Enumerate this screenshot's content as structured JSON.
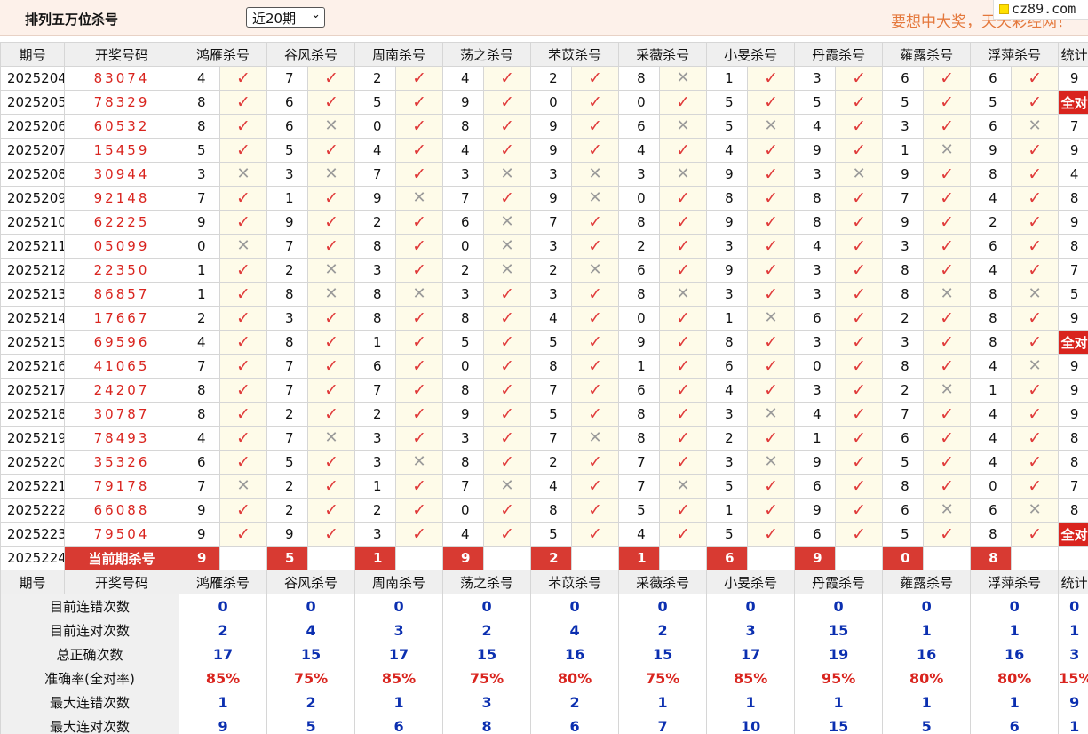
{
  "header": {
    "title": "排列五万位杀号",
    "period_select": "近20期",
    "slogan": "要想中大奖，天天彩经网！",
    "logo": "cz89.com"
  },
  "columns": {
    "period": "期号",
    "draw": "开奖号码",
    "experts": [
      "鸿雁杀号",
      "谷风杀号",
      "周南杀号",
      "荡之杀号",
      "芣苡杀号",
      "采薇杀号",
      "小旻杀号",
      "丹霞杀号",
      "蕹露杀号",
      "浮萍杀号"
    ],
    "stat": "统计"
  },
  "marks": {
    "ok": "✓",
    "ng": "✕",
    "all_ok": "全对"
  },
  "rows": [
    {
      "period": "2025204",
      "draw": "83074",
      "picks": [
        "4",
        "7",
        "2",
        "4",
        "2",
        "8",
        "1",
        "3",
        "6",
        "6"
      ],
      "ok": [
        1,
        1,
        1,
        1,
        1,
        0,
        1,
        1,
        1,
        1
      ],
      "stat": "9"
    },
    {
      "period": "2025205",
      "draw": "78329",
      "picks": [
        "8",
        "6",
        "5",
        "9",
        "0",
        "0",
        "5",
        "5",
        "5",
        "5"
      ],
      "ok": [
        1,
        1,
        1,
        1,
        1,
        1,
        1,
        1,
        1,
        1
      ],
      "stat": "全对"
    },
    {
      "period": "2025206",
      "draw": "60532",
      "picks": [
        "8",
        "6",
        "0",
        "8",
        "9",
        "6",
        "5",
        "4",
        "3",
        "6"
      ],
      "ok": [
        1,
        0,
        1,
        1,
        1,
        0,
        0,
        1,
        1,
        0
      ],
      "stat": "7"
    },
    {
      "period": "2025207",
      "draw": "15459",
      "picks": [
        "5",
        "5",
        "4",
        "4",
        "9",
        "4",
        "4",
        "9",
        "1",
        "9"
      ],
      "ok": [
        1,
        1,
        1,
        1,
        1,
        1,
        1,
        1,
        0,
        1
      ],
      "stat": "9"
    },
    {
      "period": "2025208",
      "draw": "30944",
      "picks": [
        "3",
        "3",
        "7",
        "3",
        "3",
        "3",
        "9",
        "3",
        "9",
        "8"
      ],
      "ok": [
        0,
        0,
        1,
        0,
        0,
        0,
        1,
        0,
        1,
        1
      ],
      "stat": "4"
    },
    {
      "period": "2025209",
      "draw": "92148",
      "picks": [
        "7",
        "1",
        "9",
        "7",
        "9",
        "0",
        "8",
        "8",
        "7",
        "4"
      ],
      "ok": [
        1,
        1,
        0,
        1,
        0,
        1,
        1,
        1,
        1,
        1
      ],
      "stat": "8"
    },
    {
      "period": "2025210",
      "draw": "62225",
      "picks": [
        "9",
        "9",
        "2",
        "6",
        "7",
        "8",
        "9",
        "8",
        "9",
        "2"
      ],
      "ok": [
        1,
        1,
        1,
        0,
        1,
        1,
        1,
        1,
        1,
        1
      ],
      "stat": "9"
    },
    {
      "period": "2025211",
      "draw": "05099",
      "picks": [
        "0",
        "7",
        "8",
        "0",
        "3",
        "2",
        "3",
        "4",
        "3",
        "6"
      ],
      "ok": [
        0,
        1,
        1,
        0,
        1,
        1,
        1,
        1,
        1,
        1
      ],
      "stat": "8"
    },
    {
      "period": "2025212",
      "draw": "22350",
      "picks": [
        "1",
        "2",
        "3",
        "2",
        "2",
        "6",
        "9",
        "3",
        "8",
        "4"
      ],
      "ok": [
        1,
        0,
        1,
        0,
        0,
        1,
        1,
        1,
        1,
        1
      ],
      "stat": "7"
    },
    {
      "period": "2025213",
      "draw": "86857",
      "picks": [
        "1",
        "8",
        "8",
        "3",
        "3",
        "8",
        "3",
        "3",
        "8",
        "8"
      ],
      "ok": [
        1,
        0,
        0,
        1,
        1,
        0,
        1,
        1,
        0,
        0
      ],
      "stat": "5"
    },
    {
      "period": "2025214",
      "draw": "17667",
      "picks": [
        "2",
        "3",
        "8",
        "8",
        "4",
        "0",
        "1",
        "6",
        "2",
        "8"
      ],
      "ok": [
        1,
        1,
        1,
        1,
        1,
        1,
        0,
        1,
        1,
        1
      ],
      "stat": "9"
    },
    {
      "period": "2025215",
      "draw": "69596",
      "picks": [
        "4",
        "8",
        "1",
        "5",
        "5",
        "9",
        "8",
        "3",
        "3",
        "8"
      ],
      "ok": [
        1,
        1,
        1,
        1,
        1,
        1,
        1,
        1,
        1,
        1
      ],
      "stat": "全对"
    },
    {
      "period": "2025216",
      "draw": "41065",
      "picks": [
        "7",
        "7",
        "6",
        "0",
        "8",
        "1",
        "6",
        "0",
        "8",
        "4"
      ],
      "ok": [
        1,
        1,
        1,
        1,
        1,
        1,
        1,
        1,
        1,
        0
      ],
      "stat": "9"
    },
    {
      "period": "2025217",
      "draw": "24207",
      "picks": [
        "8",
        "7",
        "7",
        "8",
        "7",
        "6",
        "4",
        "3",
        "2",
        "1"
      ],
      "ok": [
        1,
        1,
        1,
        1,
        1,
        1,
        1,
        1,
        0,
        1
      ],
      "stat": "9"
    },
    {
      "period": "2025218",
      "draw": "30787",
      "picks": [
        "8",
        "2",
        "2",
        "9",
        "5",
        "8",
        "3",
        "4",
        "7",
        "4"
      ],
      "ok": [
        1,
        1,
        1,
        1,
        1,
        1,
        0,
        1,
        1,
        1
      ],
      "stat": "9"
    },
    {
      "period": "2025219",
      "draw": "78493",
      "picks": [
        "4",
        "7",
        "3",
        "3",
        "7",
        "8",
        "2",
        "1",
        "6",
        "4"
      ],
      "ok": [
        1,
        0,
        1,
        1,
        0,
        1,
        1,
        1,
        1,
        1
      ],
      "stat": "8"
    },
    {
      "period": "2025220",
      "draw": "35326",
      "picks": [
        "6",
        "5",
        "3",
        "8",
        "2",
        "7",
        "3",
        "9",
        "5",
        "4"
      ],
      "ok": [
        1,
        1,
        0,
        1,
        1,
        1,
        0,
        1,
        1,
        1
      ],
      "stat": "8"
    },
    {
      "period": "2025221",
      "draw": "79178",
      "picks": [
        "7",
        "2",
        "1",
        "7",
        "4",
        "7",
        "5",
        "6",
        "8",
        "0"
      ],
      "ok": [
        0,
        1,
        1,
        0,
        1,
        0,
        1,
        1,
        1,
        1
      ],
      "stat": "7"
    },
    {
      "period": "2025222",
      "draw": "66088",
      "picks": [
        "9",
        "2",
        "2",
        "0",
        "8",
        "5",
        "1",
        "9",
        "6",
        "6"
      ],
      "ok": [
        1,
        1,
        1,
        1,
        1,
        1,
        1,
        1,
        0,
        0
      ],
      "stat": "8"
    },
    {
      "period": "2025223",
      "draw": "79504",
      "picks": [
        "9",
        "9",
        "3",
        "4",
        "5",
        "4",
        "5",
        "6",
        "5",
        "8"
      ],
      "ok": [
        1,
        1,
        1,
        1,
        1,
        1,
        1,
        1,
        1,
        1
      ],
      "stat": "全对"
    }
  ],
  "current": {
    "period": "2025224",
    "label": "当前期杀号",
    "picks": [
      "9",
      "5",
      "1",
      "9",
      "2",
      "1",
      "6",
      "9",
      "0",
      "8"
    ]
  },
  "stats": [
    {
      "label": "目前连错次数",
      "values": [
        "0",
        "0",
        "0",
        "0",
        "0",
        "0",
        "0",
        "0",
        "0",
        "0",
        "0"
      ]
    },
    {
      "label": "目前连对次数",
      "values": [
        "2",
        "4",
        "3",
        "2",
        "4",
        "2",
        "3",
        "15",
        "1",
        "1",
        "1"
      ]
    },
    {
      "label": "总正确次数",
      "values": [
        "17",
        "15",
        "17",
        "15",
        "16",
        "15",
        "17",
        "19",
        "16",
        "16",
        "3"
      ]
    },
    {
      "label": "准确率(全对率)",
      "values": [
        "85%",
        "75%",
        "85%",
        "75%",
        "80%",
        "75%",
        "85%",
        "95%",
        "80%",
        "80%",
        "15%"
      ],
      "red": true
    },
    {
      "label": "最大连错次数",
      "values": [
        "1",
        "2",
        "1",
        "3",
        "2",
        "1",
        "1",
        "1",
        "1",
        "1",
        "9"
      ]
    },
    {
      "label": "最大连对次数",
      "values": [
        "9",
        "5",
        "6",
        "8",
        "6",
        "7",
        "10",
        "15",
        "5",
        "6",
        "1"
      ]
    }
  ]
}
